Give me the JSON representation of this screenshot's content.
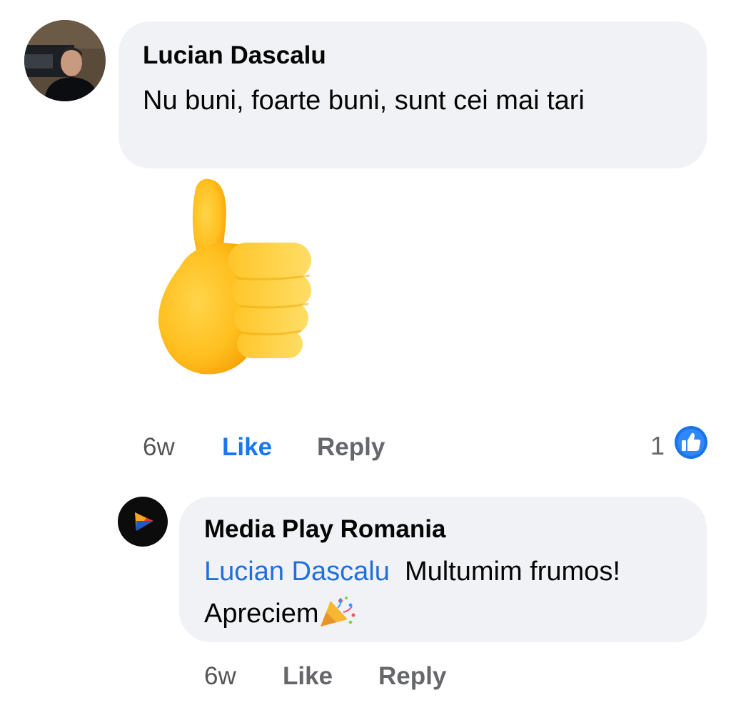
{
  "comments": [
    {
      "author": "Lucian Dascalu",
      "text": "Nu buni, foarte buni, sunt cei mai tari",
      "sticker": "thumbs-up-sticker",
      "time": "6w",
      "like_label": "Like",
      "reply_label": "Reply",
      "reaction_count": "1",
      "reaction_icon": "like-reaction-icon",
      "liked": true
    }
  ],
  "reply": {
    "author": "Media Play Romania",
    "mention": "Lucian Dascalu",
    "text": "Multumim frumos! Apreciem",
    "emoji": "party-popper-icon",
    "time": "6w",
    "like_label": "Like",
    "reply_label": "Reply"
  },
  "colors": {
    "bubble": "#f0f2f5",
    "like_active": "#1877f2",
    "mention": "#216fdb",
    "secondary_text": "#65676b"
  }
}
